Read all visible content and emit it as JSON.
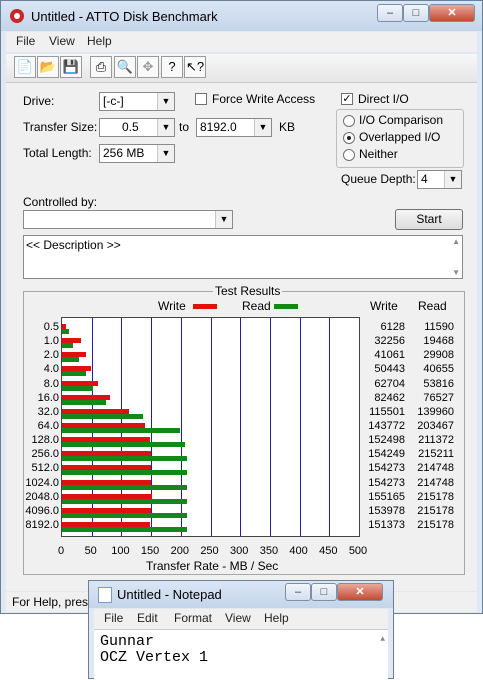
{
  "atto": {
    "title": "Untitled - ATTO Disk Benchmark",
    "menu": [
      "File",
      "View",
      "Help"
    ],
    "toolbar_icons": [
      "new-icon",
      "open-icon",
      "save-icon",
      "print-icon",
      "print-preview-icon",
      "move-icon",
      "help-icon",
      "context-help-icon"
    ],
    "drive_label": "Drive:",
    "drive_value": "[-c-]",
    "force_write_label": "Force Write Access",
    "force_write_checked": false,
    "direct_io_label": "Direct I/O",
    "direct_io_checked": true,
    "transfer_size_label": "Transfer Size:",
    "transfer_from": "0.5",
    "to_label": "to",
    "transfer_to": "8192.0",
    "kb_label": "KB",
    "total_length_label": "Total Length:",
    "total_length_value": "256 MB",
    "io_options": [
      "I/O Comparison",
      "Overlapped I/O",
      "Neither"
    ],
    "io_selected": "Overlapped I/O",
    "queue_depth_label": "Queue Depth:",
    "queue_depth_value": "4",
    "controlled_by_label": "Controlled by:",
    "controlled_by_value": "",
    "start_label": "Start",
    "description": "<< Description >>",
    "results_title": "Test Results",
    "legend_write": "Write",
    "legend_read": "Read",
    "col_write": "Write",
    "col_read": "Read",
    "status": "For Help, press"
  },
  "chart_data": {
    "type": "bar",
    "title": "Test Results",
    "xlabel": "Transfer Rate - MB / Sec",
    "xlim": [
      0,
      500
    ],
    "xticks": [
      "0",
      "50",
      "100",
      "150",
      "200",
      "250",
      "300",
      "350",
      "400",
      "450",
      "500"
    ],
    "categories": [
      "0.5",
      "1.0",
      "2.0",
      "4.0",
      "8.0",
      "16.0",
      "32.0",
      "64.0",
      "128.0",
      "256.0",
      "512.0",
      "1024.0",
      "2048.0",
      "4096.0",
      "8192.0"
    ],
    "series": [
      {
        "name": "Write",
        "color": "#e01010",
        "values_kb": [
          6128,
          32256,
          41061,
          50443,
          62704,
          82462,
          115501,
          143772,
          152498,
          154249,
          154273,
          154273,
          155165,
          153978,
          151373
        ]
      },
      {
        "name": "Read",
        "color": "#12871a",
        "values_kb": [
          11590,
          19468,
          29908,
          40655,
          53816,
          76527,
          139960,
          203467,
          211372,
          215211,
          214748,
          214748,
          215178,
          215178,
          215178
        ]
      }
    ]
  },
  "notepad": {
    "title": "Untitled - Notepad",
    "menu": [
      "File",
      "Edit",
      "Format",
      "View",
      "Help"
    ],
    "lines": [
      "Gunnar",
      "OCZ Vertex 1"
    ]
  }
}
